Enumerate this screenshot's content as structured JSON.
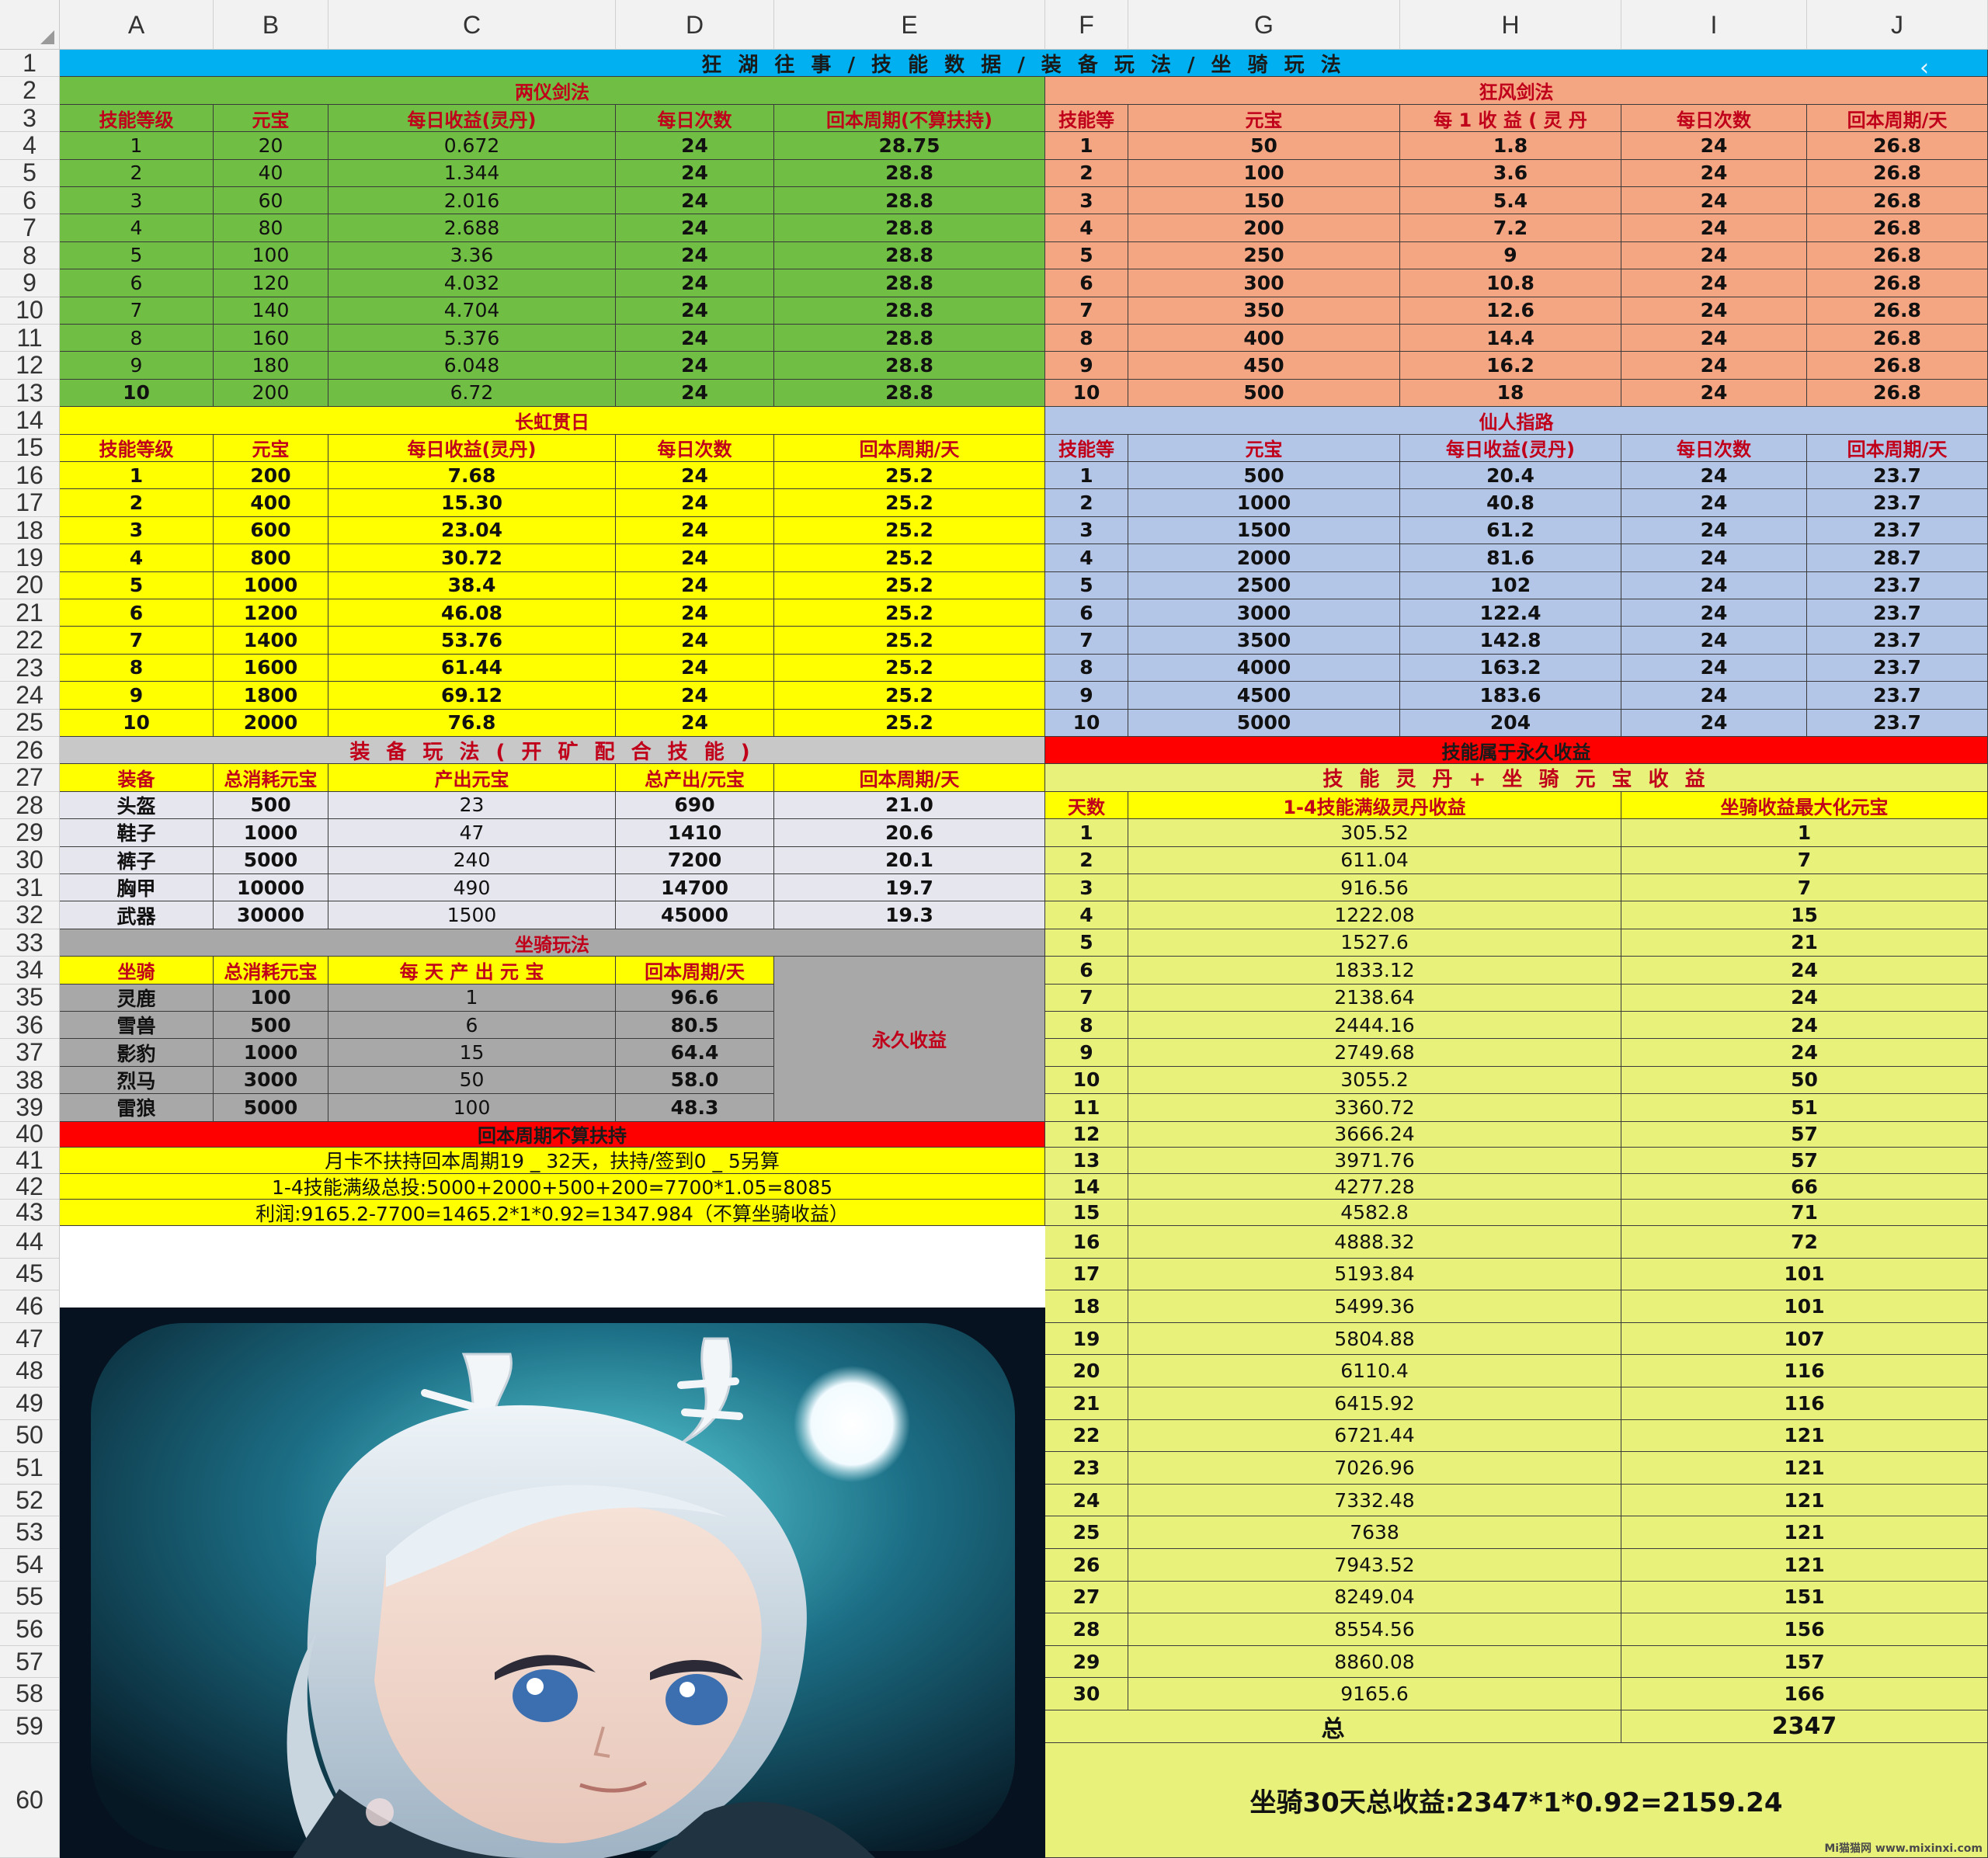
{
  "spreadsheet": {
    "column_headers": [
      "A",
      "B",
      "C",
      "D",
      "E",
      "F",
      "G",
      "H",
      "I",
      "J"
    ],
    "row_headers": [
      "1",
      "2",
      "3",
      "4",
      "5",
      "6",
      "7",
      "8",
      "9",
      "10",
      "11",
      "12",
      "13",
      "14",
      "15",
      "16",
      "17",
      "18",
      "19",
      "20",
      "21",
      "22",
      "23",
      "24",
      "25",
      "26",
      "27",
      "28",
      "29",
      "30",
      "31",
      "32",
      "33",
      "34",
      "35",
      "36",
      "37",
      "38",
      "39",
      "40",
      "41",
      "42",
      "43",
      "44",
      "45",
      "46",
      "47",
      "48",
      "49",
      "50",
      "51",
      "52",
      "53",
      "54",
      "55",
      "56",
      "57",
      "58",
      "59",
      "60"
    ]
  },
  "main_title": "狂 湖 往 事 / 技 能 数 据 / 装 备 玩 法 / 坐 骑 玩 法",
  "colors": {
    "title_blue": "#00b0f0",
    "green": "#70bf44",
    "salmon": "#f4a582",
    "yellow": "#ffff00",
    "lavender": "#b4c6e7",
    "gray": "#c8c8c8",
    "red": "#ff0000",
    "light_yellow": "#e8f27a",
    "header_text": "#c0001a"
  },
  "icons": {
    "back": "back-arrow-icon"
  },
  "liangyi": {
    "title": "两仪剑法",
    "headers": [
      "技能等级",
      "元宝",
      "每日收益(灵丹)",
      "每日次数",
      "回本周期(不算扶持)"
    ],
    "rows": [
      [
        "1",
        "20",
        "0.672",
        "24",
        "28.75"
      ],
      [
        "2",
        "40",
        "1.344",
        "24",
        "28.8"
      ],
      [
        "3",
        "60",
        "2.016",
        "24",
        "28.8"
      ],
      [
        "4",
        "80",
        "2.688",
        "24",
        "28.8"
      ],
      [
        "5",
        "100",
        "3.36",
        "24",
        "28.8"
      ],
      [
        "6",
        "120",
        "4.032",
        "24",
        "28.8"
      ],
      [
        "7",
        "140",
        "4.704",
        "24",
        "28.8"
      ],
      [
        "8",
        "160",
        "5.376",
        "24",
        "28.8"
      ],
      [
        "9",
        "180",
        "6.048",
        "24",
        "28.8"
      ],
      [
        "10",
        "200",
        "6.72",
        "24",
        "28.8"
      ]
    ]
  },
  "kuangfeng": {
    "title": "狂风剑法",
    "headers": [
      "技能等",
      "元宝",
      "每 1 收 益 ( 灵 丹",
      "每日次数",
      "回本周期/天"
    ],
    "rows": [
      [
        "1",
        "50",
        "1.8",
        "24",
        "26.8"
      ],
      [
        "2",
        "100",
        "3.6",
        "24",
        "26.8"
      ],
      [
        "3",
        "150",
        "5.4",
        "24",
        "26.8"
      ],
      [
        "4",
        "200",
        "7.2",
        "24",
        "26.8"
      ],
      [
        "5",
        "250",
        "9",
        "24",
        "26.8"
      ],
      [
        "6",
        "300",
        "10.8",
        "24",
        "26.8"
      ],
      [
        "7",
        "350",
        "12.6",
        "24",
        "26.8"
      ],
      [
        "8",
        "400",
        "14.4",
        "24",
        "26.8"
      ],
      [
        "9",
        "450",
        "16.2",
        "24",
        "26.8"
      ],
      [
        "10",
        "500",
        "18",
        "24",
        "26.8"
      ]
    ]
  },
  "changhong": {
    "title": "长虹贯日",
    "headers": [
      "技能等级",
      "元宝",
      "每日收益(灵丹)",
      "每日次数",
      "回本周期/天"
    ],
    "rows": [
      [
        "1",
        "200",
        "7.68",
        "24",
        "25.2"
      ],
      [
        "2",
        "400",
        "15.30",
        "24",
        "25.2"
      ],
      [
        "3",
        "600",
        "23.04",
        "24",
        "25.2"
      ],
      [
        "4",
        "800",
        "30.72",
        "24",
        "25.2"
      ],
      [
        "5",
        "1000",
        "38.4",
        "24",
        "25.2"
      ],
      [
        "6",
        "1200",
        "46.08",
        "24",
        "25.2"
      ],
      [
        "7",
        "1400",
        "53.76",
        "24",
        "25.2"
      ],
      [
        "8",
        "1600",
        "61.44",
        "24",
        "25.2"
      ],
      [
        "9",
        "1800",
        "69.12",
        "24",
        "25.2"
      ],
      [
        "10",
        "2000",
        "76.8",
        "24",
        "25.2"
      ]
    ]
  },
  "xianren": {
    "title": "仙人指路",
    "headers": [
      "技能等",
      "元宝",
      "每日收益(灵丹)",
      "每日次数",
      "回本周期/天"
    ],
    "rows": [
      [
        "1",
        "500",
        "20.4",
        "24",
        "23.7"
      ],
      [
        "2",
        "1000",
        "40.8",
        "24",
        "23.7"
      ],
      [
        "3",
        "1500",
        "61.2",
        "24",
        "23.7"
      ],
      [
        "4",
        "2000",
        "81.6",
        "24",
        "28.7"
      ],
      [
        "5",
        "2500",
        "102",
        "24",
        "23.7"
      ],
      [
        "6",
        "3000",
        "122.4",
        "24",
        "23.7"
      ],
      [
        "7",
        "3500",
        "142.8",
        "24",
        "23.7"
      ],
      [
        "8",
        "4000",
        "163.2",
        "24",
        "23.7"
      ],
      [
        "9",
        "4500",
        "183.6",
        "24",
        "23.7"
      ],
      [
        "10",
        "5000",
        "204",
        "24",
        "23.7"
      ]
    ]
  },
  "equipment": {
    "title": "装 备 玩 法 ( 开 矿 配 合 技 能 )",
    "headers": [
      "装备",
      "总消耗元宝",
      "产出元宝",
      "总产出/元宝",
      "回本周期/天"
    ],
    "rows": [
      [
        "头盔",
        "500",
        "23",
        "690",
        "21.0"
      ],
      [
        "鞋子",
        "1000",
        "47",
        "1410",
        "20.6"
      ],
      [
        "裤子",
        "5000",
        "240",
        "7200",
        "20.1"
      ],
      [
        "胸甲",
        "10000",
        "490",
        "14700",
        "19.7"
      ],
      [
        "武器",
        "30000",
        "1500",
        "45000",
        "19.3"
      ]
    ]
  },
  "mount": {
    "title": "坐骑玩法",
    "headers": [
      "坐骑",
      "总消耗元宝",
      "每 天 产 出 元 宝",
      "回本周期/天"
    ],
    "rows": [
      [
        "灵鹿",
        "100",
        "1",
        "96.6"
      ],
      [
        "雪兽",
        "500",
        "6",
        "80.5"
      ],
      [
        "影豹",
        "1000",
        "15",
        "64.4"
      ],
      [
        "烈马",
        "3000",
        "50",
        "58.0"
      ],
      [
        "雷狼",
        "5000",
        "100",
        "48.3"
      ]
    ],
    "side_note": "永久收益"
  },
  "support": {
    "title": "回本周期不算扶持",
    "lines": [
      "月卡不扶持回本周期19 _ 32天，扶持/签到0 _ 5另算",
      "1-4技能满级总投:5000+2000+500+200=7700*1.05=8085",
      "利润:9165.2-7700=1465.2*1*0.92=1347.984（不算坐骑收益）"
    ]
  },
  "permanent": {
    "title": "技能属于永久收益",
    "subtitle": "技 能 灵 丹 + 坐 骑 元 宝 收 益",
    "headers": [
      "天数",
      "1-4技能满级灵丹收益",
      "坐骑收益最大化元宝"
    ],
    "rows": [
      [
        "1",
        "305.52",
        "1"
      ],
      [
        "2",
        "611.04",
        "7"
      ],
      [
        "3",
        "916.56",
        "7"
      ],
      [
        "4",
        "1222.08",
        "15"
      ],
      [
        "5",
        "1527.6",
        "21"
      ],
      [
        "6",
        "1833.12",
        "24"
      ],
      [
        "7",
        "2138.64",
        "24"
      ],
      [
        "8",
        "2444.16",
        "24"
      ],
      [
        "9",
        "2749.68",
        "24"
      ],
      [
        "10",
        "3055.2",
        "50"
      ],
      [
        "11",
        "3360.72",
        "51"
      ],
      [
        "12",
        "3666.24",
        "57"
      ],
      [
        "13",
        "3971.76",
        "57"
      ],
      [
        "14",
        "4277.28",
        "66"
      ],
      [
        "15",
        "4582.8",
        "71"
      ],
      [
        "16",
        "4888.32",
        "72"
      ],
      [
        "17",
        "5193.84",
        "101"
      ],
      [
        "18",
        "5499.36",
        "101"
      ],
      [
        "19",
        "5804.88",
        "107"
      ],
      [
        "20",
        "6110.4",
        "116"
      ],
      [
        "21",
        "6415.92",
        "116"
      ],
      [
        "22",
        "6721.44",
        "121"
      ],
      [
        "23",
        "7026.96",
        "121"
      ],
      [
        "24",
        "7332.48",
        "121"
      ],
      [
        "25",
        "7638",
        "121"
      ],
      [
        "26",
        "7943.52",
        "121"
      ],
      [
        "27",
        "8249.04",
        "151"
      ],
      [
        "28",
        "8554.56",
        "156"
      ],
      [
        "29",
        "8860.08",
        "157"
      ],
      [
        "30",
        "9165.6",
        "166"
      ]
    ],
    "total_label": "总",
    "total_value": "2347",
    "summary": "坐骑30天总收益:2347*1*0.92=2159.24",
    "watermark": "Mi猫猫网 www.mixinxi.com"
  }
}
